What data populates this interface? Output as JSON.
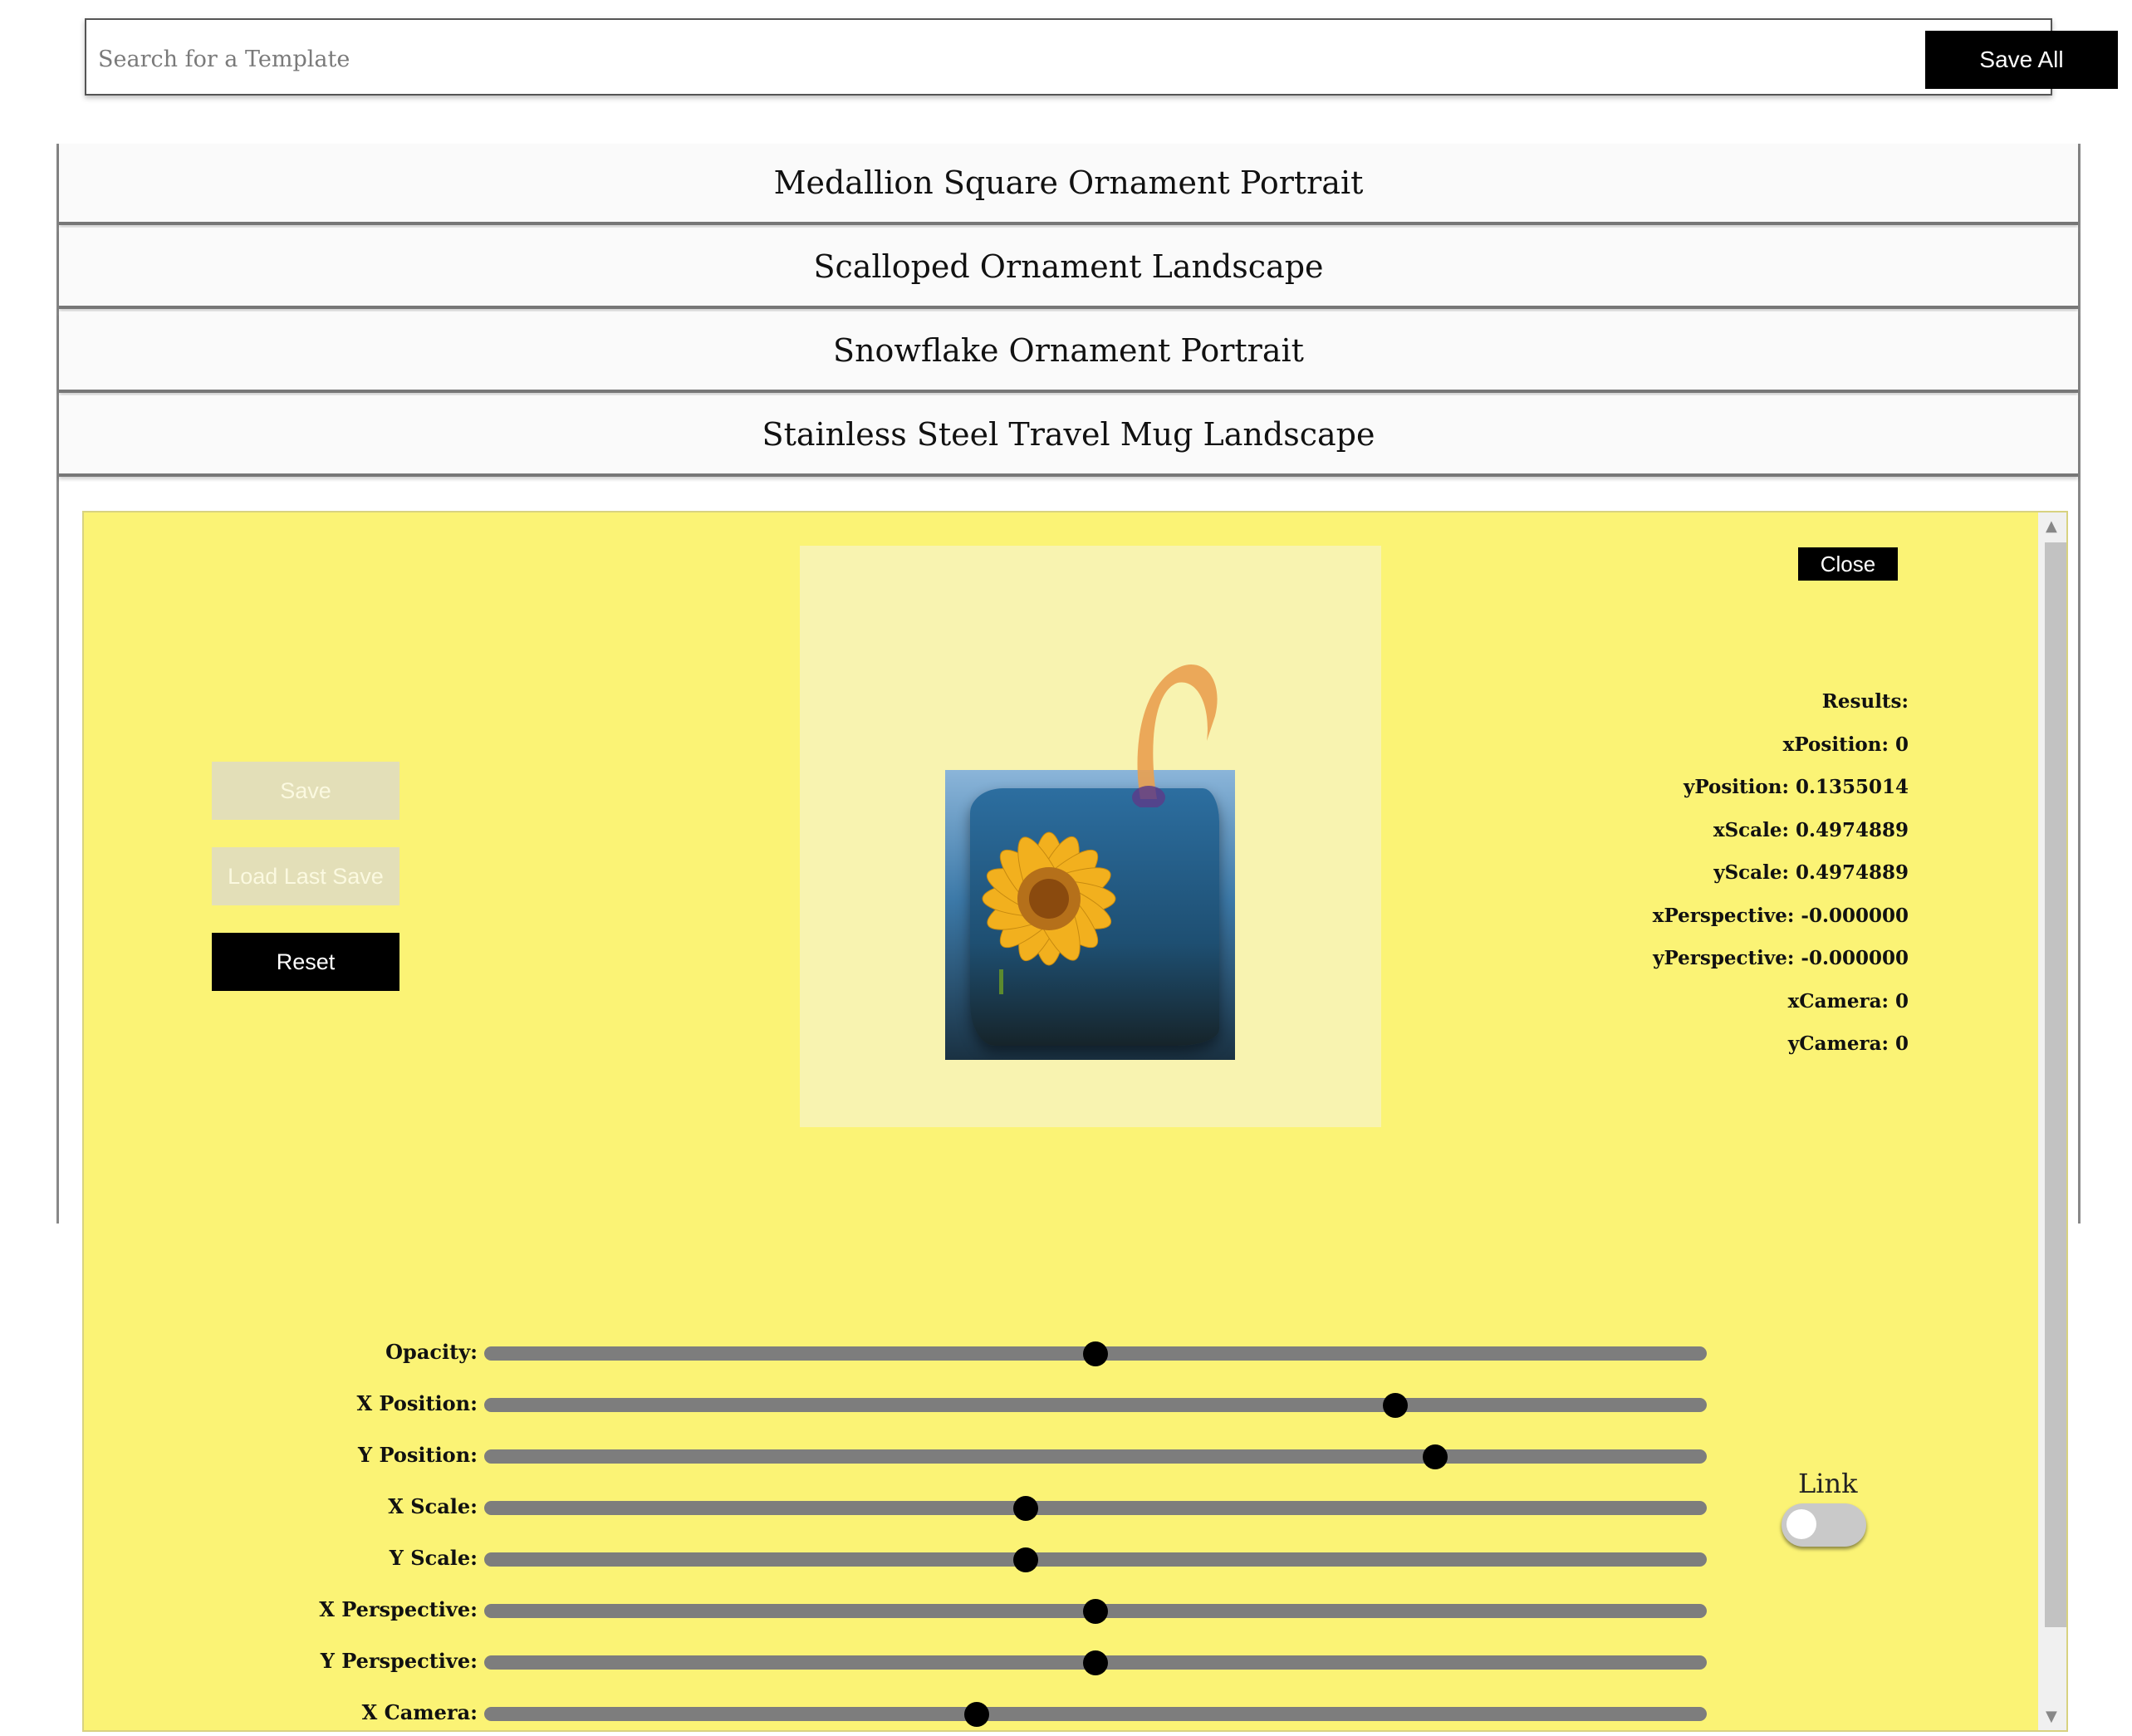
{
  "search": {
    "placeholder": "Search for a Template",
    "value": ""
  },
  "toolbar": {
    "save_all_label": "Save All"
  },
  "templates": [
    {
      "label": "Medallion Square Ornament Portrait"
    },
    {
      "label": "Scalloped Ornament Landscape"
    },
    {
      "label": "Snowflake Ornament Portrait"
    },
    {
      "label": "Stainless Steel Travel Mug Landscape"
    }
  ],
  "editor": {
    "close_label": "Close",
    "save_label": "Save",
    "load_last_save_label": "Load Last Save",
    "reset_label": "Reset",
    "results": {
      "title": "Results:",
      "xPosition": "xPosition: 0",
      "yPosition": "yPosition: 0.1355014",
      "xScale": "xScale: 0.4974889",
      "yScale": "yScale: 0.4974889",
      "xPerspective": "xPerspective: -0.000000",
      "yPerspective": "yPerspective: -0.000000",
      "xCamera": "xCamera: 0",
      "yCamera": "yCamera: 0"
    },
    "sliders": [
      {
        "label": "Opacity:",
        "value_fraction": 0.5
      },
      {
        "label": "X Position:",
        "value_fraction": 0.745
      },
      {
        "label": "Y Position:",
        "value_fraction": 0.778
      },
      {
        "label": "X Scale:",
        "value_fraction": 0.443
      },
      {
        "label": "Y Scale:",
        "value_fraction": 0.443
      },
      {
        "label": "X Perspective:",
        "value_fraction": 0.5
      },
      {
        "label": "Y Perspective:",
        "value_fraction": 0.5
      },
      {
        "label": "X Camera:",
        "value_fraction": 0.403
      }
    ],
    "link_label": "Link",
    "link_enabled": false
  },
  "colors": {
    "modal_bg": "#fbf375",
    "button_primary": "#000000",
    "button_disabled": "#e3dfb8"
  }
}
